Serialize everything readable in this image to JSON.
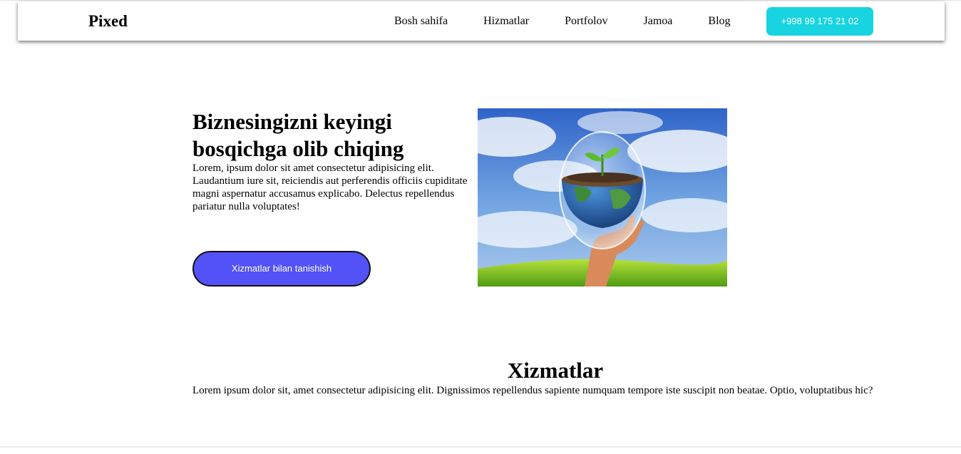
{
  "navbar": {
    "logo": "Pixed",
    "links": [
      "Bosh sahifa",
      "Hizmatlar",
      "Portfolov",
      "Jamoa",
      "Blog"
    ],
    "phone": "+998 99 175 21 02"
  },
  "hero": {
    "title": "Biznesingizni keyingi bosqichga olib chiqing",
    "text": "Lorem, ipsum dolor sit amet consectetur adipisicing elit. Laudantium iure sit, reiciendis aut perferendis officiis cupiditate magni aspernatur accusamus explicabo. Delectus repellendus pariatur nulla voluptates!",
    "button_label": "Xizmatlar bilan tanishish",
    "image_alt": "hand-holding-earth-globe-with-sprout"
  },
  "services": {
    "title": "Xizmatlar",
    "text": "Lorem ipsum dolor sit, amet consectetur adipisicing elit. Dignissimos repellendus sapiente numquam tempore iste suscipit non beatae. Optio, voluptatibus hic?"
  },
  "colors": {
    "phone_button": "#17d4e0",
    "hero_button": "#5252f7",
    "text": "#000000"
  }
}
